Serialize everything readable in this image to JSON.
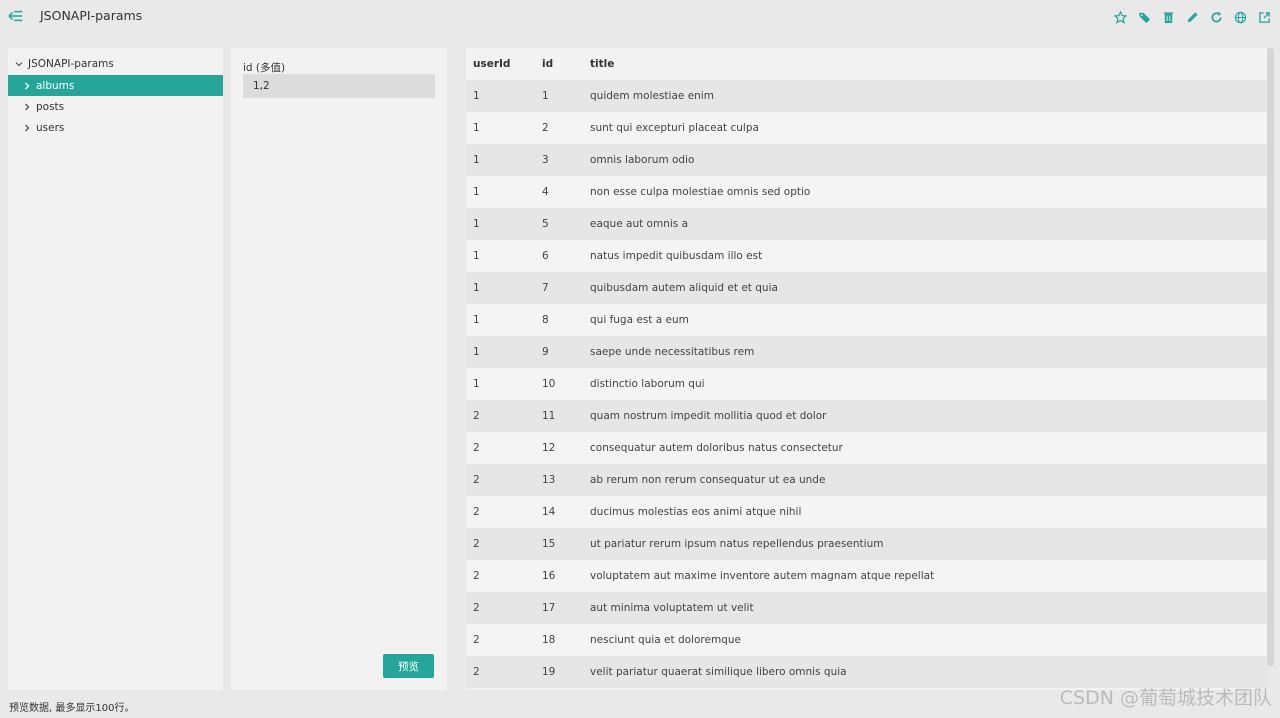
{
  "app": {
    "title": "JSONAPI-params"
  },
  "colors": {
    "accent": "#26a69a"
  },
  "toolbar": {
    "icons": [
      "star-icon",
      "tag-icon",
      "trash-icon",
      "pencil-icon",
      "refresh-icon",
      "globe-icon",
      "external-link-icon"
    ]
  },
  "tree": {
    "root": "JSONAPI-params",
    "items": [
      {
        "label": "albums"
      },
      {
        "label": "posts"
      },
      {
        "label": "users"
      }
    ]
  },
  "params": {
    "label": "id (多值)",
    "value": "1,2",
    "preview_label": "预览"
  },
  "table": {
    "columns": [
      "userId",
      "id",
      "title"
    ],
    "rows": [
      [
        "1",
        "1",
        "quidem molestiae enim"
      ],
      [
        "1",
        "2",
        "sunt qui excepturi placeat culpa"
      ],
      [
        "1",
        "3",
        "omnis laborum odio"
      ],
      [
        "1",
        "4",
        "non esse culpa molestiae omnis sed optio"
      ],
      [
        "1",
        "5",
        "eaque aut omnis a"
      ],
      [
        "1",
        "6",
        "natus impedit quibusdam illo est"
      ],
      [
        "1",
        "7",
        "quibusdam autem aliquid et et quia"
      ],
      [
        "1",
        "8",
        "qui fuga est a eum"
      ],
      [
        "1",
        "9",
        "saepe unde necessitatibus rem"
      ],
      [
        "1",
        "10",
        "distinctio laborum qui"
      ],
      [
        "2",
        "11",
        "quam nostrum impedit mollitia quod et dolor"
      ],
      [
        "2",
        "12",
        "consequatur autem doloribus natus consectetur"
      ],
      [
        "2",
        "13",
        "ab rerum non rerum consequatur ut ea unde"
      ],
      [
        "2",
        "14",
        "ducimus molestias eos animi atque nihil"
      ],
      [
        "2",
        "15",
        "ut pariatur rerum ipsum natus repellendus praesentium"
      ],
      [
        "2",
        "16",
        "voluptatem aut maxime inventore autem magnam atque repellat"
      ],
      [
        "2",
        "17",
        "aut minima voluptatem ut velit"
      ],
      [
        "2",
        "18",
        "nesciunt quia et doloremque"
      ],
      [
        "2",
        "19",
        "velit pariatur quaerat similique libero omnis quia"
      ]
    ]
  },
  "status": {
    "text": "预览数据, 最多显示100行。"
  },
  "watermark": "CSDN @葡萄城技术团队"
}
